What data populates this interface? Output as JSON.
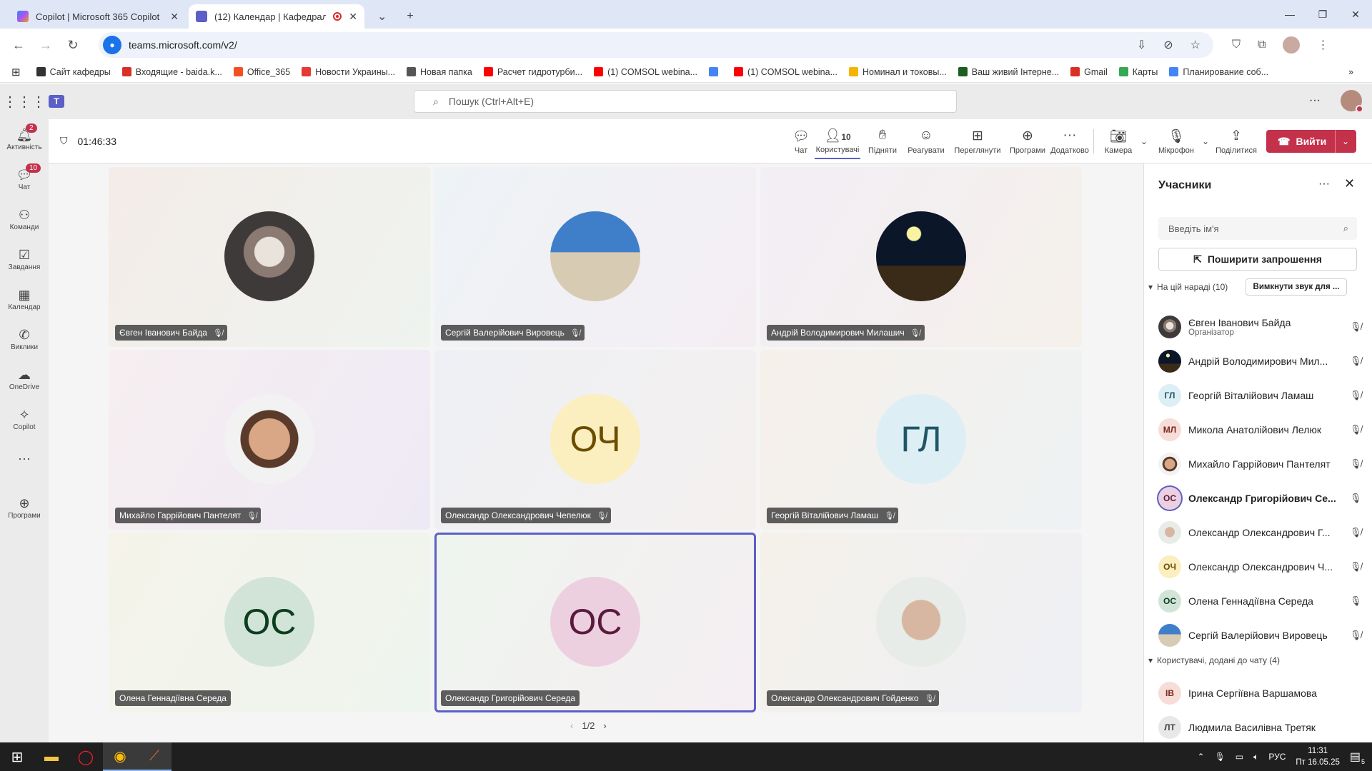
{
  "browser": {
    "tabs": [
      {
        "label": "Copilot | Microsoft 365 Copilot",
        "icon": "copilot-icon",
        "active": false
      },
      {
        "label": "(12) Календар | Кафедраль",
        "icon": "teams-icon",
        "active": true
      }
    ],
    "url": "teams.microsoft.com/v2/",
    "bookmarks": [
      {
        "label": "Сайт кафедры",
        "color": "#333333"
      },
      {
        "label": "Входящие - baida.k...",
        "color": "#d93025"
      },
      {
        "label": "Office_365",
        "color": "#f25022"
      },
      {
        "label": "Новости Украины...",
        "color": "#e53935"
      },
      {
        "label": "Новая папка",
        "color": "#555555"
      },
      {
        "label": "Расчет гидротурби...",
        "color": "#ff0000"
      },
      {
        "label": "(1) COMSOL webina...",
        "color": "#ff0000"
      },
      {
        "label": "",
        "color": "#4285f4"
      },
      {
        "label": "(1) COMSOL webina...",
        "color": "#ff0000"
      },
      {
        "label": "Номинал и токовы...",
        "color": "#f4b400"
      },
      {
        "label": "Ваш живий Інтерне...",
        "color": "#1b5e20"
      },
      {
        "label": "Gmail",
        "color": "#d93025"
      },
      {
        "label": "Карты",
        "color": "#34a853"
      },
      {
        "label": "Планирование соб...",
        "color": "#4285f4"
      }
    ]
  },
  "teams_top": {
    "search_placeholder": "Пошук (Ctrl+Alt+E)"
  },
  "rail": [
    {
      "label": "Активність",
      "icon": "bell-icon",
      "badge": "2"
    },
    {
      "label": "Чат",
      "icon": "chat-icon",
      "badge": "10"
    },
    {
      "label": "Команди",
      "icon": "teams-group-icon",
      "badge": ""
    },
    {
      "label": "Завдання",
      "icon": "tasks-icon",
      "badge": ""
    },
    {
      "label": "Календар",
      "icon": "calendar-icon",
      "badge": ""
    },
    {
      "label": "Виклики",
      "icon": "phone-icon",
      "badge": ""
    },
    {
      "label": "OneDrive",
      "icon": "cloud-icon",
      "badge": ""
    },
    {
      "label": "Copilot",
      "icon": "copilot-icon",
      "badge": ""
    },
    {
      "label": "...",
      "icon": "more-icon",
      "badge": ""
    },
    {
      "label": "Програми",
      "icon": "apps-icon",
      "badge": ""
    }
  ],
  "meeting_bar": {
    "timer": "01:46:33",
    "buttons": [
      {
        "label": "Чат",
        "icon": "chat-icon"
      },
      {
        "label": "Користувачі",
        "icon": "people-icon",
        "count": "10"
      },
      {
        "label": "Підняти",
        "icon": "raise-hand-icon"
      },
      {
        "label": "Реагувати",
        "icon": "react-icon"
      },
      {
        "label": "Переглянути",
        "icon": "view-icon"
      },
      {
        "label": "Програми",
        "icon": "apps-icon"
      },
      {
        "label": "Додатково",
        "icon": "more-icon"
      },
      {
        "label": "Камера",
        "icon": "camera-off-icon"
      },
      {
        "label": "Мікрофон",
        "icon": "mic-off-icon"
      },
      {
        "label": "Поділитися",
        "icon": "share-icon"
      }
    ],
    "leave": "Вийти"
  },
  "tiles": [
    {
      "name": "Євген Іванович Байда",
      "initials": "",
      "avatar": "photo",
      "bg": "#e6ddd8",
      "muted": true
    },
    {
      "name": "Сергій Валерійович Вировець",
      "initials": "",
      "avatar": "beach",
      "bg": "#8fb4d9",
      "muted": true
    },
    {
      "name": "Андрій Володимирович Милашич",
      "initials": "",
      "avatar": "night",
      "bg": "#0e1a2e",
      "muted": true
    },
    {
      "name": "Михайло Гаррійович Пантелят",
      "initials": "",
      "avatar": "photo2",
      "bg": "#c49a7a",
      "muted": true
    },
    {
      "name": "Олександр Олександрович Чепелюк",
      "initials": "ОЧ",
      "avatar": "initials",
      "bg": "#fbeebf",
      "color": "#6b4d00",
      "muted": true
    },
    {
      "name": "Георгій Віталійович Ламаш",
      "initials": "ГЛ",
      "avatar": "initials",
      "bg": "#ddeef4",
      "color": "#1f5666",
      "muted": true
    },
    {
      "name": "Олена Геннадіївна Середа",
      "initials": "ОС",
      "avatar": "initials",
      "bg": "#d2e4d7",
      "color": "#0d3d1f",
      "muted": false
    },
    {
      "name": "Олександр Григорійович Середа",
      "initials": "ОС",
      "avatar": "initials",
      "bg": "#ecd0e0",
      "color": "#5a1a3d",
      "muted": false
    },
    {
      "name": "Олександр Олександрович Гойденко",
      "initials": "",
      "avatar": "photo3",
      "bg": "#e5d9d3",
      "muted": true
    }
  ],
  "pager": "1/2",
  "panel": {
    "title": "Учасники",
    "search_placeholder": "Введіть ім'я",
    "share_invite": "Поширити запрошення",
    "section_meeting": "На цій нараді (10)",
    "mute_all": "Вимкнути звук для ...",
    "participants": [
      {
        "name": "Євген Іванович Байда",
        "role": "Організатор",
        "initials": "",
        "bg": "#c7b8b0",
        "color": "#333333",
        "mic": "off"
      },
      {
        "name": "Андрій Володимирович Мил...",
        "role": "",
        "initials": "",
        "bg": "#0e1a2e",
        "color": "#ffffff",
        "mic": "off"
      },
      {
        "name": "Георгій Віталійович Ламаш",
        "role": "",
        "initials": "ГЛ",
        "bg": "#ddeef4",
        "color": "#1f5666",
        "mic": "off"
      },
      {
        "name": "Микола Анатолійович Лелюк",
        "role": "",
        "initials": "МЛ",
        "bg": "#f7dcd8",
        "color": "#7a2b1f",
        "mic": "off"
      },
      {
        "name": "Михайло Гаррійович Пантелят",
        "role": "",
        "initials": "",
        "bg": "#c49a7a",
        "color": "#333333",
        "mic": "off"
      },
      {
        "name": "Олександр Григорійович Се...",
        "role": "",
        "initials": "ОС",
        "bg": "#ecd0e0",
        "color": "#5a1a3d",
        "mic": "on",
        "bold": true
      },
      {
        "name": "Олександр Олександрович Г...",
        "role": "",
        "initials": "",
        "bg": "#e5d9d3",
        "color": "#333333",
        "mic": "off"
      },
      {
        "name": "Олександр Олександрович Ч...",
        "role": "",
        "initials": "ОЧ",
        "bg": "#fbeebf",
        "color": "#6b4d00",
        "mic": "off"
      },
      {
        "name": "Олена Геннадіївна Середа",
        "role": "",
        "initials": "ОС",
        "bg": "#d2e4d7",
        "color": "#0d3d1f",
        "mic": "on"
      },
      {
        "name": "Сергій Валерійович Вировець",
        "role": "",
        "initials": "",
        "bg": "#8fb4d9",
        "color": "#333333",
        "mic": "off"
      }
    ],
    "section_chat": "Користувачі, додані до чату (4)",
    "chat_users": [
      {
        "name": "Ірина Сергіївна Варшамова",
        "initials": "ІВ",
        "bg": "#f7dcd8",
        "color": "#7a2b1f"
      },
      {
        "name": "Людмила Василівна Третяк",
        "initials": "ЛТ",
        "bg": "#e8e8e8",
        "color": "#424242"
      }
    ]
  },
  "taskbar": {
    "lang": "РУС",
    "time": "11:31",
    "date": "Пт 16.05.25",
    "notif_count": "5"
  }
}
